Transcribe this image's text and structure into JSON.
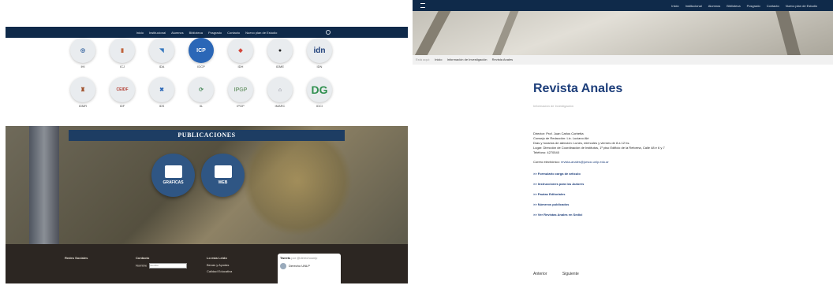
{
  "left": {
    "nav": {
      "items": [
        "Inicio",
        "Institucional",
        "Alumnos",
        "Biblioteca",
        "Posgrado",
        "Contacto",
        "Nuevo plan de Estudio"
      ]
    },
    "icons_row1": [
      "IHI",
      "ICJ",
      "IDA",
      "IDCP",
      "IDH",
      "IDME",
      "IDN"
    ],
    "icons_row2": [
      "IDMR",
      "IDF",
      "IDS",
      "IIL",
      "IPGP",
      "IMARC",
      "IDCI"
    ],
    "publicaciones": {
      "title": "PUBLICACIONES",
      "btn_graficas": "GRAFICAS",
      "btn_web": "WEB"
    },
    "footer": {
      "col1": "Redes Sociales",
      "col2": "Contacto",
      "col2_field": "Nombre",
      "col3": "Lo más Leído",
      "col3_items": [
        "Becas y Ayudas",
        "Calidad Educativa"
      ],
      "tweets_title": "Tweets",
      "tweets_handle": "por @derechounlp",
      "tweet_user": "Derecho UNLP"
    }
  },
  "right": {
    "nav": {
      "items": [
        "Inicio",
        "Institucional",
        "Alumnos",
        "Biblioteca",
        "Posgrado",
        "Contacto",
        "Nuevo plan de Estudio"
      ]
    },
    "breadcrumb": {
      "lead": "Está aquí:",
      "items": [
        "Inicio",
        "Información de Investigación",
        "Revista Anales"
      ]
    },
    "article": {
      "title": "Revista Anales",
      "subtitle": "Información de Investigación",
      "lines": [
        "Director: Prof. Juan Carlos Corbetta",
        "Consejo de Redacción: Lic. Luciano Alé",
        "Días y horarios de atención: Lunes, miércoles y viernes de 8 a 12 hs.",
        "Lugar: Dirección de Coordinación de Institutos, 1º piso Edificio de la Reforma, Calle 48 e 6 y 7",
        "Teléfono: 4270540"
      ],
      "email_label": "Correo electrónico:",
      "email": "revista-anales@jursoc.unlp.edu.ar",
      "links": [
        ">> Formulario carga de artículo",
        ">> Instrucciones para los Autores",
        ">> Pautas Editoriales",
        ">> Números publicados",
        ">> Ver Revistas Anales en Sedici"
      ]
    },
    "pager": {
      "prev": "Anterior",
      "next": "Siguiente"
    }
  }
}
